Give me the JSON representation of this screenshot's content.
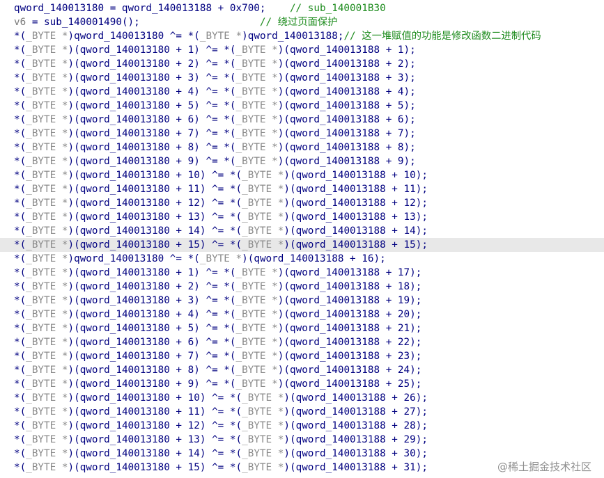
{
  "editor": {
    "highlight_line": 17,
    "lines": [
      [
        {
          "t": "qword_140013180 = qword_140013188 + 0x700;    ",
          "c": "plain"
        },
        {
          "t": "// sub_140001B30",
          "c": "cmt"
        }
      ],
      [
        {
          "t": "v6",
          "c": "local"
        },
        {
          "t": " = sub_140001490();                    ",
          "c": "plain"
        },
        {
          "t": "// 绕过页面保护",
          "c": "cmt"
        }
      ],
      [
        {
          "t": "*(",
          "c": "plain"
        },
        {
          "t": "_BYTE *",
          "c": "cast"
        },
        {
          "t": ")qword_140013180 ^= *(",
          "c": "plain"
        },
        {
          "t": "_BYTE *",
          "c": "cast"
        },
        {
          "t": ")qword_140013188;",
          "c": "plain"
        },
        {
          "t": "// 这一堆赋值的功能是修改函数二进制代码",
          "c": "cmt"
        }
      ],
      [
        {
          "t": "*(",
          "c": "plain"
        },
        {
          "t": "_BYTE *",
          "c": "cast"
        },
        {
          "t": ")(qword_140013180 + 1) ^= *(",
          "c": "plain"
        },
        {
          "t": "_BYTE *",
          "c": "cast"
        },
        {
          "t": ")(qword_140013188 + 1);",
          "c": "plain"
        }
      ],
      [
        {
          "t": "*(",
          "c": "plain"
        },
        {
          "t": "_BYTE *",
          "c": "cast"
        },
        {
          "t": ")(qword_140013180 + 2) ^= *(",
          "c": "plain"
        },
        {
          "t": "_BYTE *",
          "c": "cast"
        },
        {
          "t": ")(qword_140013188 + 2);",
          "c": "plain"
        }
      ],
      [
        {
          "t": "*(",
          "c": "plain"
        },
        {
          "t": "_BYTE *",
          "c": "cast"
        },
        {
          "t": ")(qword_140013180 + 3) ^= *(",
          "c": "plain"
        },
        {
          "t": "_BYTE *",
          "c": "cast"
        },
        {
          "t": ")(qword_140013188 + 3);",
          "c": "plain"
        }
      ],
      [
        {
          "t": "*(",
          "c": "plain"
        },
        {
          "t": "_BYTE *",
          "c": "cast"
        },
        {
          "t": ")(qword_140013180 + 4) ^= *(",
          "c": "plain"
        },
        {
          "t": "_BYTE *",
          "c": "cast"
        },
        {
          "t": ")(qword_140013188 + 4);",
          "c": "plain"
        }
      ],
      [
        {
          "t": "*(",
          "c": "plain"
        },
        {
          "t": "_BYTE *",
          "c": "cast"
        },
        {
          "t": ")(qword_140013180 + 5) ^= *(",
          "c": "plain"
        },
        {
          "t": "_BYTE *",
          "c": "cast"
        },
        {
          "t": ")(qword_140013188 + 5);",
          "c": "plain"
        }
      ],
      [
        {
          "t": "*(",
          "c": "plain"
        },
        {
          "t": "_BYTE *",
          "c": "cast"
        },
        {
          "t": ")(qword_140013180 + 6) ^= *(",
          "c": "plain"
        },
        {
          "t": "_BYTE *",
          "c": "cast"
        },
        {
          "t": ")(qword_140013188 + 6);",
          "c": "plain"
        }
      ],
      [
        {
          "t": "*(",
          "c": "plain"
        },
        {
          "t": "_BYTE *",
          "c": "cast"
        },
        {
          "t": ")(qword_140013180 + 7) ^= *(",
          "c": "plain"
        },
        {
          "t": "_BYTE *",
          "c": "cast"
        },
        {
          "t": ")(qword_140013188 + 7);",
          "c": "plain"
        }
      ],
      [
        {
          "t": "*(",
          "c": "plain"
        },
        {
          "t": "_BYTE *",
          "c": "cast"
        },
        {
          "t": ")(qword_140013180 + 8) ^= *(",
          "c": "plain"
        },
        {
          "t": "_BYTE *",
          "c": "cast"
        },
        {
          "t": ")(qword_140013188 + 8);",
          "c": "plain"
        }
      ],
      [
        {
          "t": "*(",
          "c": "plain"
        },
        {
          "t": "_BYTE *",
          "c": "cast"
        },
        {
          "t": ")(qword_140013180 + 9) ^= *(",
          "c": "plain"
        },
        {
          "t": "_BYTE *",
          "c": "cast"
        },
        {
          "t": ")(qword_140013188 + 9);",
          "c": "plain"
        }
      ],
      [
        {
          "t": "*(",
          "c": "plain"
        },
        {
          "t": "_BYTE *",
          "c": "cast"
        },
        {
          "t": ")(qword_140013180 + 10) ^= *(",
          "c": "plain"
        },
        {
          "t": "_BYTE *",
          "c": "cast"
        },
        {
          "t": ")(qword_140013188 + 10);",
          "c": "plain"
        }
      ],
      [
        {
          "t": "*(",
          "c": "plain"
        },
        {
          "t": "_BYTE *",
          "c": "cast"
        },
        {
          "t": ")(qword_140013180 + 11) ^= *(",
          "c": "plain"
        },
        {
          "t": "_BYTE *",
          "c": "cast"
        },
        {
          "t": ")(qword_140013188 + 11);",
          "c": "plain"
        }
      ],
      [
        {
          "t": "*(",
          "c": "plain"
        },
        {
          "t": "_BYTE *",
          "c": "cast"
        },
        {
          "t": ")(qword_140013180 + 12) ^= *(",
          "c": "plain"
        },
        {
          "t": "_BYTE *",
          "c": "cast"
        },
        {
          "t": ")(qword_140013188 + 12);",
          "c": "plain"
        }
      ],
      [
        {
          "t": "*(",
          "c": "plain"
        },
        {
          "t": "_BYTE *",
          "c": "cast"
        },
        {
          "t": ")(qword_140013180 + 13) ^= *(",
          "c": "plain"
        },
        {
          "t": "_BYTE *",
          "c": "cast"
        },
        {
          "t": ")(qword_140013188 + 13);",
          "c": "plain"
        }
      ],
      [
        {
          "t": "*(",
          "c": "plain"
        },
        {
          "t": "_BYTE *",
          "c": "cast"
        },
        {
          "t": ")(qword_140013180 + 14) ^= *(",
          "c": "plain"
        },
        {
          "t": "_BYTE *",
          "c": "cast"
        },
        {
          "t": ")(qword_140013188 + 14);",
          "c": "plain"
        }
      ],
      [
        {
          "t": "*(",
          "c": "plain"
        },
        {
          "t": "_BYTE *",
          "c": "cast"
        },
        {
          "t": ")(qword_140013180 + 15) ^= *(",
          "c": "plain"
        },
        {
          "t": "_BYTE *",
          "c": "cast"
        },
        {
          "t": ")(qword_140013188 + 15);",
          "c": "plain"
        }
      ],
      [
        {
          "t": "*(",
          "c": "plain"
        },
        {
          "t": "_BYTE *",
          "c": "cast"
        },
        {
          "t": ")qword_140013180 ^= *(",
          "c": "plain"
        },
        {
          "t": "_BYTE *",
          "c": "cast"
        },
        {
          "t": ")(qword_140013188 + 16);",
          "c": "plain"
        }
      ],
      [
        {
          "t": "*(",
          "c": "plain"
        },
        {
          "t": "_BYTE *",
          "c": "cast"
        },
        {
          "t": ")(qword_140013180 + 1) ^= *(",
          "c": "plain"
        },
        {
          "t": "_BYTE *",
          "c": "cast"
        },
        {
          "t": ")(qword_140013188 + 17);",
          "c": "plain"
        }
      ],
      [
        {
          "t": "*(",
          "c": "plain"
        },
        {
          "t": "_BYTE *",
          "c": "cast"
        },
        {
          "t": ")(qword_140013180 + 2) ^= *(",
          "c": "plain"
        },
        {
          "t": "_BYTE *",
          "c": "cast"
        },
        {
          "t": ")(qword_140013188 + 18);",
          "c": "plain"
        }
      ],
      [
        {
          "t": "*(",
          "c": "plain"
        },
        {
          "t": "_BYTE *",
          "c": "cast"
        },
        {
          "t": ")(qword_140013180 + 3) ^= *(",
          "c": "plain"
        },
        {
          "t": "_BYTE *",
          "c": "cast"
        },
        {
          "t": ")(qword_140013188 + 19);",
          "c": "plain"
        }
      ],
      [
        {
          "t": "*(",
          "c": "plain"
        },
        {
          "t": "_BYTE *",
          "c": "cast"
        },
        {
          "t": ")(qword_140013180 + 4) ^= *(",
          "c": "plain"
        },
        {
          "t": "_BYTE *",
          "c": "cast"
        },
        {
          "t": ")(qword_140013188 + 20);",
          "c": "plain"
        }
      ],
      [
        {
          "t": "*(",
          "c": "plain"
        },
        {
          "t": "_BYTE *",
          "c": "cast"
        },
        {
          "t": ")(qword_140013180 + 5) ^= *(",
          "c": "plain"
        },
        {
          "t": "_BYTE *",
          "c": "cast"
        },
        {
          "t": ")(qword_140013188 + 21);",
          "c": "plain"
        }
      ],
      [
        {
          "t": "*(",
          "c": "plain"
        },
        {
          "t": "_BYTE *",
          "c": "cast"
        },
        {
          "t": ")(qword_140013180 + 6) ^= *(",
          "c": "plain"
        },
        {
          "t": "_BYTE *",
          "c": "cast"
        },
        {
          "t": ")(qword_140013188 + 22);",
          "c": "plain"
        }
      ],
      [
        {
          "t": "*(",
          "c": "plain"
        },
        {
          "t": "_BYTE *",
          "c": "cast"
        },
        {
          "t": ")(qword_140013180 + 7) ^= *(",
          "c": "plain"
        },
        {
          "t": "_BYTE *",
          "c": "cast"
        },
        {
          "t": ")(qword_140013188 + 23);",
          "c": "plain"
        }
      ],
      [
        {
          "t": "*(",
          "c": "plain"
        },
        {
          "t": "_BYTE *",
          "c": "cast"
        },
        {
          "t": ")(qword_140013180 + 8) ^= *(",
          "c": "plain"
        },
        {
          "t": "_BYTE *",
          "c": "cast"
        },
        {
          "t": ")(qword_140013188 + 24);",
          "c": "plain"
        }
      ],
      [
        {
          "t": "*(",
          "c": "plain"
        },
        {
          "t": "_BYTE *",
          "c": "cast"
        },
        {
          "t": ")(qword_140013180 + 9) ^= *(",
          "c": "plain"
        },
        {
          "t": "_BYTE *",
          "c": "cast"
        },
        {
          "t": ")(qword_140013188 + 25);",
          "c": "plain"
        }
      ],
      [
        {
          "t": "*(",
          "c": "plain"
        },
        {
          "t": "_BYTE *",
          "c": "cast"
        },
        {
          "t": ")(qword_140013180 + 10) ^= *(",
          "c": "plain"
        },
        {
          "t": "_BYTE *",
          "c": "cast"
        },
        {
          "t": ")(qword_140013188 + 26);",
          "c": "plain"
        }
      ],
      [
        {
          "t": "*(",
          "c": "plain"
        },
        {
          "t": "_BYTE *",
          "c": "cast"
        },
        {
          "t": ")(qword_140013180 + 11) ^= *(",
          "c": "plain"
        },
        {
          "t": "_BYTE *",
          "c": "cast"
        },
        {
          "t": ")(qword_140013188 + 27);",
          "c": "plain"
        }
      ],
      [
        {
          "t": "*(",
          "c": "plain"
        },
        {
          "t": "_BYTE *",
          "c": "cast"
        },
        {
          "t": ")(qword_140013180 + 12) ^= *(",
          "c": "plain"
        },
        {
          "t": "_BYTE *",
          "c": "cast"
        },
        {
          "t": ")(qword_140013188 + 28);",
          "c": "plain"
        }
      ],
      [
        {
          "t": "*(",
          "c": "plain"
        },
        {
          "t": "_BYTE *",
          "c": "cast"
        },
        {
          "t": ")(qword_140013180 + 13) ^= *(",
          "c": "plain"
        },
        {
          "t": "_BYTE *",
          "c": "cast"
        },
        {
          "t": ")(qword_140013188 + 29);",
          "c": "plain"
        }
      ],
      [
        {
          "t": "*(",
          "c": "plain"
        },
        {
          "t": "_BYTE *",
          "c": "cast"
        },
        {
          "t": ")(qword_140013180 + 14) ^= *(",
          "c": "plain"
        },
        {
          "t": "_BYTE *",
          "c": "cast"
        },
        {
          "t": ")(qword_140013188 + 30);",
          "c": "plain"
        }
      ],
      [
        {
          "t": "*(",
          "c": "plain"
        },
        {
          "t": "_BYTE *",
          "c": "cast"
        },
        {
          "t": ")(qword_140013180 + 15) ^= *(",
          "c": "plain"
        },
        {
          "t": "_BYTE *",
          "c": "cast"
        },
        {
          "t": ")(qword_140013188 + 31);",
          "c": "plain"
        }
      ]
    ]
  },
  "watermark": "@稀土掘金技术社区",
  "colors": {
    "code": "#000080",
    "cast": "#8a8a8a",
    "local": "#7a7a7a",
    "comment": "#1e8c1e",
    "highlight": "#e8e8e8",
    "background": "#ffffff"
  }
}
